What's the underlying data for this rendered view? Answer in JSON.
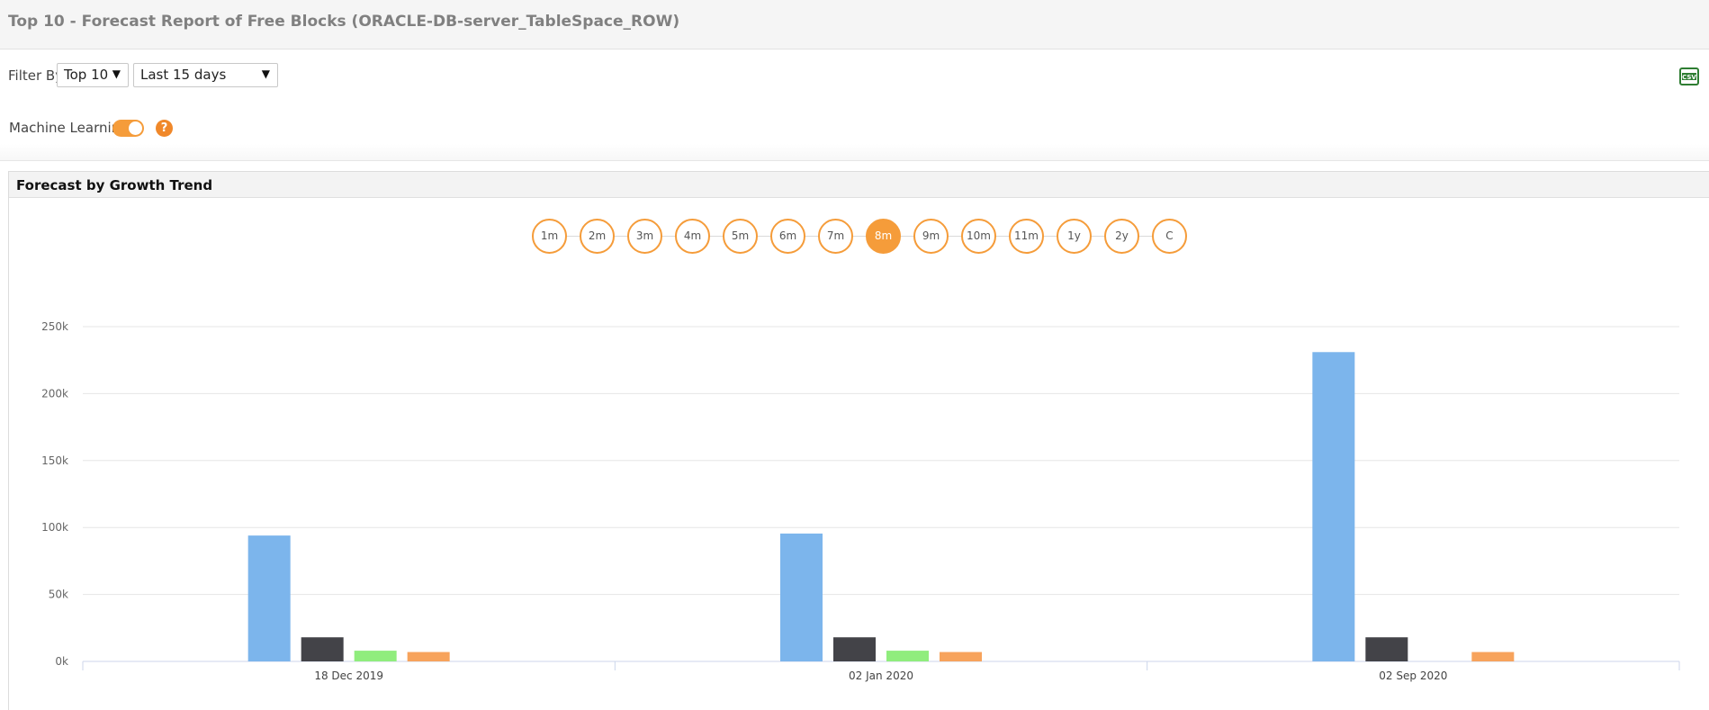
{
  "header": {
    "title": "Top 10 - Forecast Report of Free Blocks (ORACLE-DB-server_TableSpace_ROW)"
  },
  "filters": {
    "label": "Filter By",
    "top_select": "Top 10",
    "range_select": "Last 15 days",
    "export_icon": "csv-export-icon"
  },
  "ml": {
    "label": "Machine Learning",
    "toggle_on": true,
    "help_label": "?"
  },
  "panel": {
    "title": "Forecast by Growth Trend"
  },
  "periods": [
    {
      "label": "1m",
      "active": false
    },
    {
      "label": "2m",
      "active": false
    },
    {
      "label": "3m",
      "active": false
    },
    {
      "label": "4m",
      "active": false
    },
    {
      "label": "5m",
      "active": false
    },
    {
      "label": "6m",
      "active": false
    },
    {
      "label": "7m",
      "active": false
    },
    {
      "label": "8m",
      "active": true
    },
    {
      "label": "9m",
      "active": false
    },
    {
      "label": "10m",
      "active": false
    },
    {
      "label": "11m",
      "active": false
    },
    {
      "label": "1y",
      "active": false
    },
    {
      "label": "2y",
      "active": false
    },
    {
      "label": "C",
      "active": false
    }
  ],
  "colors": {
    "accent": "#f59c3a",
    "series": [
      "#7cb5ec",
      "#434348",
      "#90ed7d",
      "#f7a35c"
    ]
  },
  "chart_data": {
    "type": "bar",
    "title": "",
    "xlabel": "",
    "ylabel": "",
    "categories": [
      "18 Dec 2019",
      "02 Jan 2020",
      "02 Sep 2020"
    ],
    "ylim": [
      0,
      250000
    ],
    "yticks": [
      "0k",
      "50k",
      "100k",
      "150k",
      "200k",
      "250k"
    ],
    "series": [
      {
        "values": [
          94000,
          95500,
          231000
        ]
      },
      {
        "values": [
          18000,
          18000,
          18000
        ]
      },
      {
        "values": [
          8000,
          8000,
          0
        ]
      },
      {
        "values": [
          7000,
          7000,
          7000
        ]
      }
    ],
    "grid": true,
    "legend": "none"
  }
}
